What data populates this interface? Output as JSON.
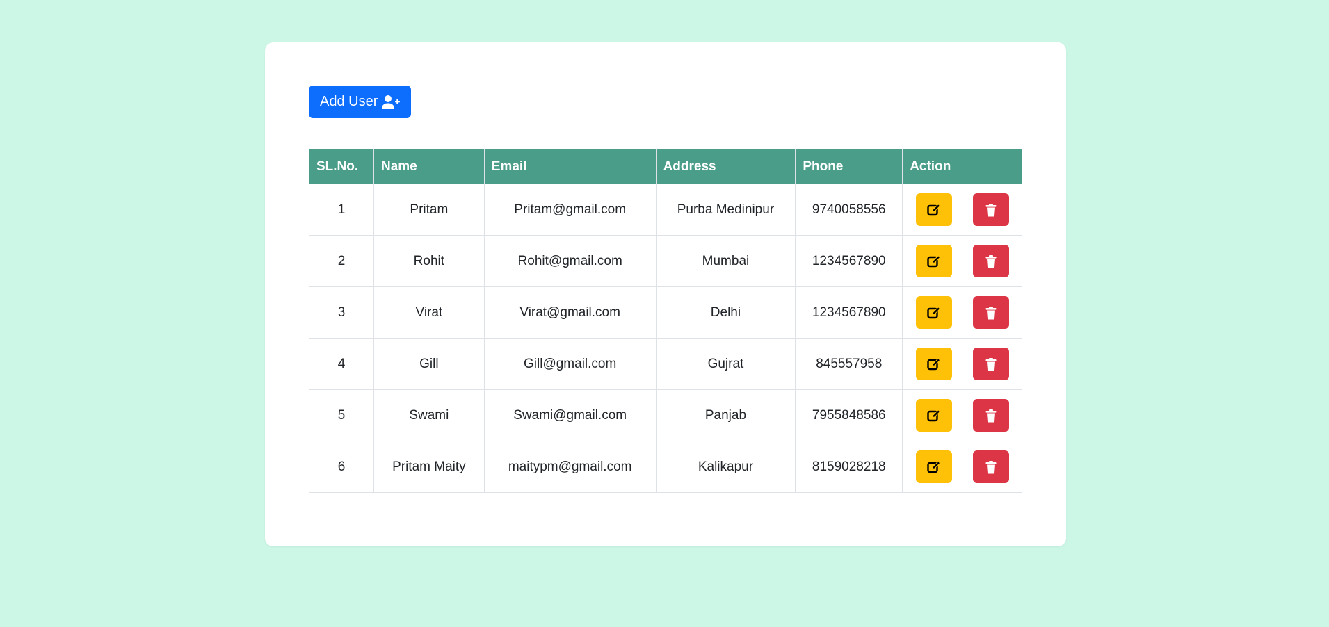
{
  "add_user": {
    "label": "Add User",
    "icon": "user-plus-icon"
  },
  "table": {
    "headers": [
      "SL.No.",
      "Name",
      "Email",
      "Address",
      "Phone",
      "Action"
    ],
    "rows": [
      {
        "sl": "1",
        "name": "Pritam",
        "email": "Pritam@gmail.com",
        "address": "Purba Medinipur",
        "phone": "9740058556"
      },
      {
        "sl": "2",
        "name": "Rohit",
        "email": "Rohit@gmail.com",
        "address": "Mumbai",
        "phone": "1234567890"
      },
      {
        "sl": "3",
        "name": "Virat",
        "email": "Virat@gmail.com",
        "address": "Delhi",
        "phone": "1234567890"
      },
      {
        "sl": "4",
        "name": "Gill",
        "email": "Gill@gmail.com",
        "address": "Gujrat",
        "phone": "845557958"
      },
      {
        "sl": "5",
        "name": "Swami",
        "email": "Swami@gmail.com",
        "address": "Panjab",
        "phone": "7955848586"
      },
      {
        "sl": "6",
        "name": "Pritam Maity",
        "email": "maitypm@gmail.com",
        "address": "Kalikapur",
        "phone": "8159028218"
      }
    ],
    "action_icons": {
      "edit": "edit-icon",
      "delete": "trash-icon"
    }
  },
  "colors": {
    "page_background": "#ccf7e6",
    "card_background": "#ffffff",
    "primary_button": "#0d6efd",
    "header_background": "#4a9d88",
    "edit_button": "#ffc107",
    "delete_button": "#dc3545"
  }
}
